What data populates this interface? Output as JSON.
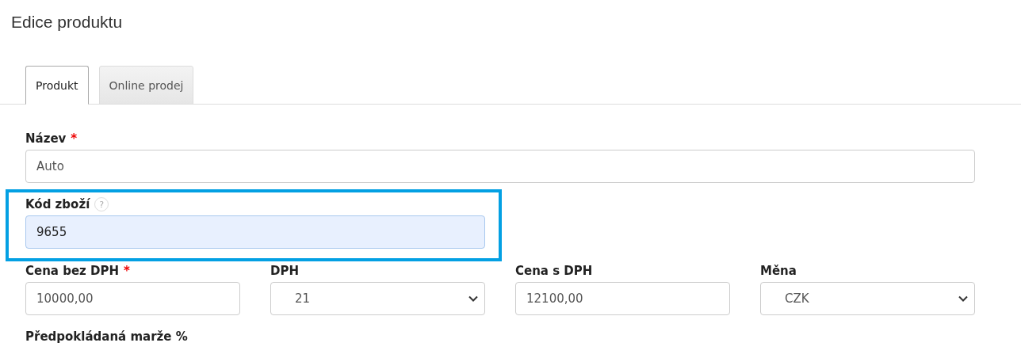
{
  "page_title": "Edice produktu",
  "tabs": [
    {
      "label": "Produkt",
      "selected": true
    },
    {
      "label": "Online prodej",
      "selected": false
    }
  ],
  "form_rows": [
    {
      "fields": [
        {
          "kind": "text",
          "label": "Název",
          "required_mark": "*",
          "value": "Auto",
          "highlighted": false
        }
      ]
    },
    {
      "fields": [
        {
          "kind": "text",
          "label": "Kód zboží",
          "help": "?",
          "value": "9655",
          "highlighted": true,
          "autofilled": true
        }
      ]
    },
    {
      "fields": [
        {
          "kind": "text",
          "label": "Cena bez DPH",
          "required_mark": "*",
          "value": "10000,00",
          "highlighted": false
        },
        {
          "kind": "select",
          "label": "DPH",
          "value": "21",
          "highlighted": false
        },
        {
          "kind": "text",
          "label": "Cena s DPH",
          "value": "12100,00",
          "highlighted": false
        },
        {
          "kind": "select",
          "label": "Měna",
          "value": "CZK",
          "highlighted": false
        }
      ]
    },
    {
      "fields": [
        {
          "kind": "label",
          "label": "Předpokládaná marže %",
          "highlighted": false
        }
      ]
    }
  ]
}
